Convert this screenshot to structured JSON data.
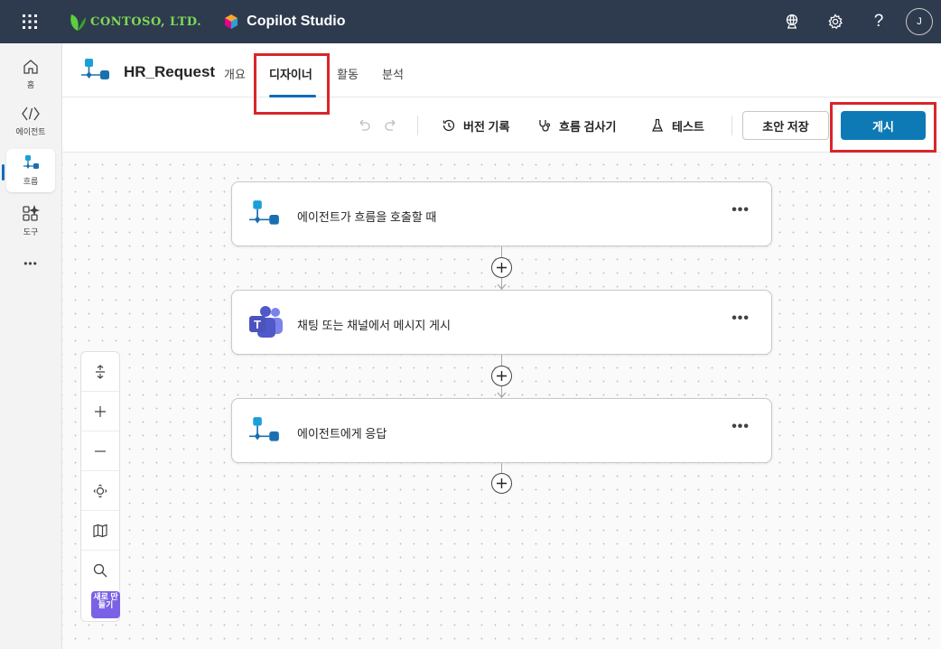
{
  "topbar": {
    "company": "CONTOSO, LTD.",
    "product": "Copilot Studio",
    "avatar_initial": "J",
    "help_label": "?"
  },
  "rail": {
    "items": [
      {
        "label": "홈",
        "icon": "home-icon"
      },
      {
        "label": "에이전트",
        "icon": "agent-icon"
      },
      {
        "label": "흐름",
        "icon": "flow-icon"
      },
      {
        "label": "도구",
        "icon": "tools-icon"
      }
    ],
    "more_label": "•••"
  },
  "header": {
    "title": "HR_Request",
    "tabs": [
      {
        "label": "개요"
      },
      {
        "label": "디자이너"
      },
      {
        "label": "활동"
      },
      {
        "label": "분석"
      }
    ]
  },
  "toolbar": {
    "version_history": "버전 기록",
    "flow_checker": "흐름 검사기",
    "test": "테스트",
    "save_draft": "초안 저장",
    "publish": "게시"
  },
  "flow": {
    "steps": [
      {
        "label": "에이전트가 흐름을 호출할 때",
        "icon": "flow-icon"
      },
      {
        "label": "채팅 또는 채널에서 메시지 게시",
        "icon": "teams-icon"
      },
      {
        "label": "에이전트에게 응답",
        "icon": "flow-icon"
      }
    ],
    "more_label": "•••"
  },
  "zoom": {
    "new_label": "새로 만들기"
  },
  "colors": {
    "topbar": "#2e3b4e",
    "accent": "#0f6cbd",
    "publish": "#0e7ab5",
    "highlight": "#d9262b"
  }
}
